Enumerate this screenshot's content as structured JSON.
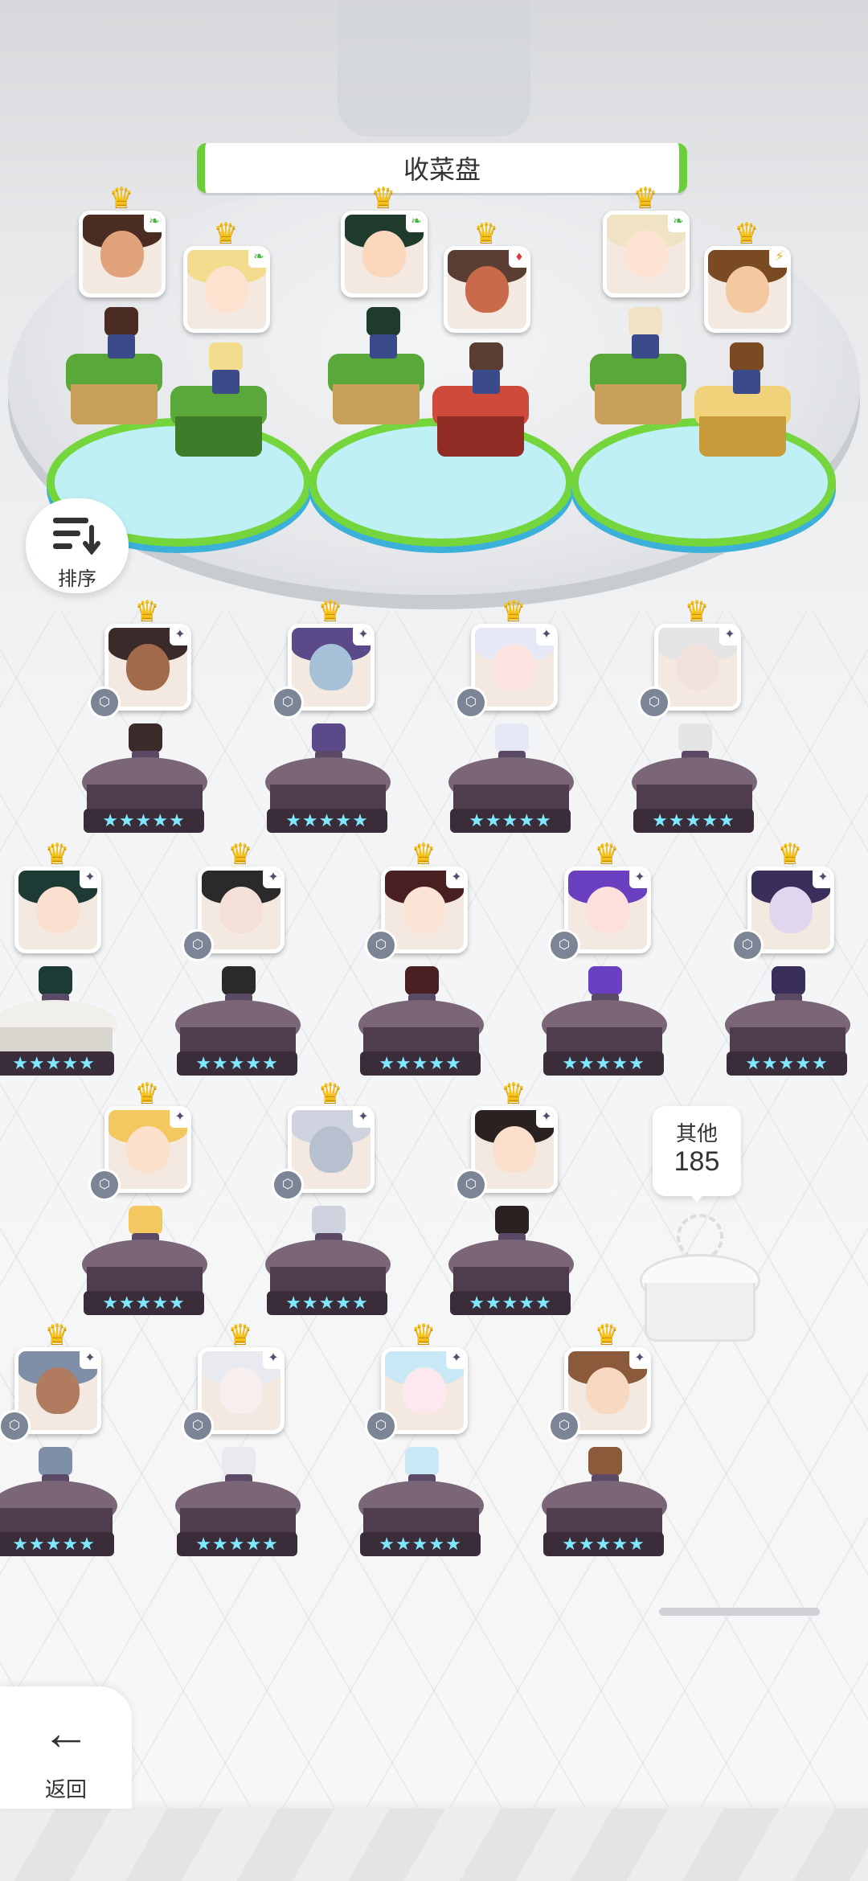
{
  "header": {
    "title": "收菜盘"
  },
  "sort_button": {
    "label": "排序",
    "icon": "sort-icon"
  },
  "back_button": {
    "label": "返回",
    "icon": "back-arrow-icon"
  },
  "others": {
    "label": "其他",
    "count": "185"
  },
  "colors": {
    "accent_green": "#6ccf3a",
    "crown_gold": "#f5c21b",
    "pedestal_dark": "#4f3d4e",
    "star_cyan": "#7fe8ff"
  },
  "party": [
    {
      "name": "party-hero-1",
      "element": "green-leaf",
      "hair": "#4a2c22",
      "skin": "#e0a27a"
    },
    {
      "name": "party-hero-2",
      "element": "green-leaf",
      "hair": "#f3dc8d",
      "skin": "#fde3cf"
    },
    {
      "name": "party-hero-3",
      "element": "green-leaf",
      "hair": "#1e3b2c",
      "skin": "#fbd7bc"
    },
    {
      "name": "party-hero-4",
      "element": "red-diamond",
      "hair": "#5a3e33",
      "skin": "#c96a4a"
    },
    {
      "name": "party-hero-5",
      "element": "green-leaf",
      "hair": "#efe3c3",
      "skin": "#fde4d2"
    },
    {
      "name": "party-hero-6",
      "element": "yellow-bolt",
      "hair": "#7a4a23",
      "skin": "#f4c9a1"
    }
  ],
  "stars_text": "★★★★★"
}
